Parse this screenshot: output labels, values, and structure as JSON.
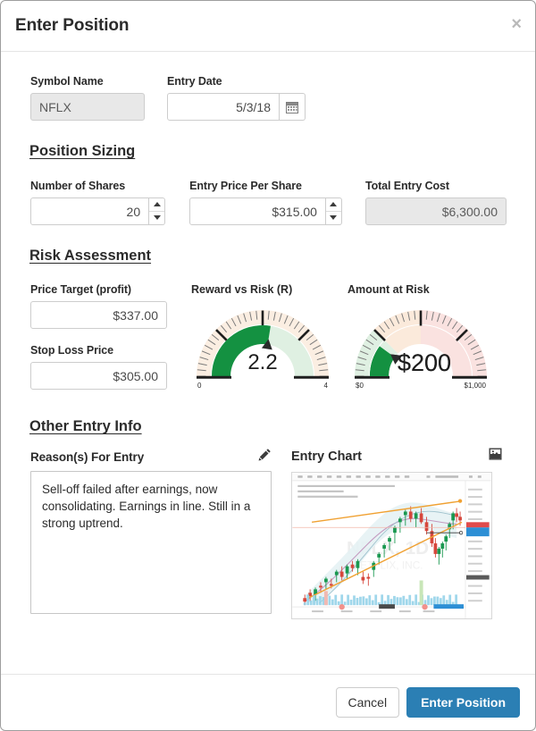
{
  "dialog": {
    "title": "Enter Position",
    "close_label": "×"
  },
  "top_fields": {
    "symbol_label": "Symbol Name",
    "symbol_value": "NFLX",
    "date_label": "Entry Date",
    "date_value": "5/3/18",
    "calendar_icon": "calendar-icon"
  },
  "position_sizing": {
    "heading": "Position Sizing",
    "shares_label": "Number of Shares",
    "shares_value": "20",
    "price_label": "Entry Price Per Share",
    "price_value": "$315.00",
    "total_label": "Total Entry Cost",
    "total_value": "$6,300.00"
  },
  "risk_assessment": {
    "heading": "Risk Assessment",
    "target_label": "Price Target (profit)",
    "target_value": "$337.00",
    "stop_label": "Stop Loss Price",
    "stop_value": "$305.00",
    "gauge_reward": {
      "title": "Reward vs Risk (R)",
      "value_text": "2.2",
      "value": 2.2,
      "min": 0,
      "max": 4,
      "min_label": "0",
      "max_label": "4",
      "fill_color": "#149141",
      "track_color": "#dff0e2",
      "outer_ring_color": "#fbeee2"
    },
    "gauge_risk": {
      "title": "Amount at Risk",
      "value_text": "$200",
      "value": 200,
      "min": 0,
      "max": 1000,
      "min_label": "$0",
      "max_label": "$1,000",
      "fill_color": "#149141",
      "bands": [
        {
          "to": 250,
          "color": "#dff0e2"
        },
        {
          "to": 500,
          "color": "#fbeadb"
        },
        {
          "to": 1000,
          "color": "#fae2e0"
        }
      ]
    }
  },
  "other_entry_info": {
    "heading": "Other Entry Info",
    "reason_label": "Reason(s) For Entry",
    "reason_edit_icon": "pencil-icon",
    "reason_text": "Sell-off failed after earnings, now consolidating. Earnings in line. Still in a strong uptrend.",
    "chart_label": "Entry Chart",
    "chart_expand_icon": "image-icon",
    "chart_watermark_symbol": "NFLX, 1D",
    "chart_watermark_name": "NETFLIX, INC."
  },
  "footer": {
    "cancel_label": "Cancel",
    "submit_label": "Enter Position",
    "primary_color": "#2b7fb4"
  }
}
